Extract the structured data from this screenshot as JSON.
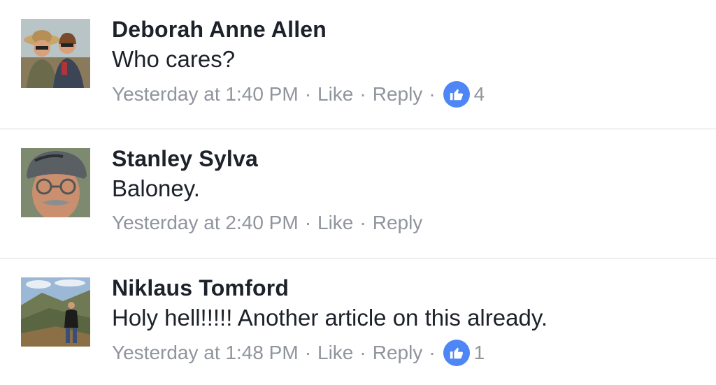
{
  "comments": [
    {
      "name": "Deborah Anne Allen",
      "text": "Who cares?",
      "time": "Yesterday at 1:40 PM",
      "like_label": "Like",
      "reply_label": "Reply",
      "reactions": "4",
      "avatar_icon": "avatar-two-women-in-hats"
    },
    {
      "name": "Stanley Sylva",
      "text": "Baloney.",
      "time": "Yesterday at 2:40 PM",
      "like_label": "Like",
      "reply_label": "Reply",
      "avatar_icon": "avatar-man-in-cap-with-glasses"
    },
    {
      "name": "Niklaus Tomford",
      "text": "Holy hell!!!!! Another article on this already.",
      "time": "Yesterday at 1:48 PM",
      "like_label": "Like",
      "reply_label": "Reply",
      "reactions": "1",
      "avatar_icon": "avatar-man-on-mountain"
    }
  ],
  "separator": "·",
  "colors": {
    "name": "#1d2129",
    "meta": "#90949c",
    "like_badge": "#4e86f6",
    "divider": "#dadde1"
  }
}
